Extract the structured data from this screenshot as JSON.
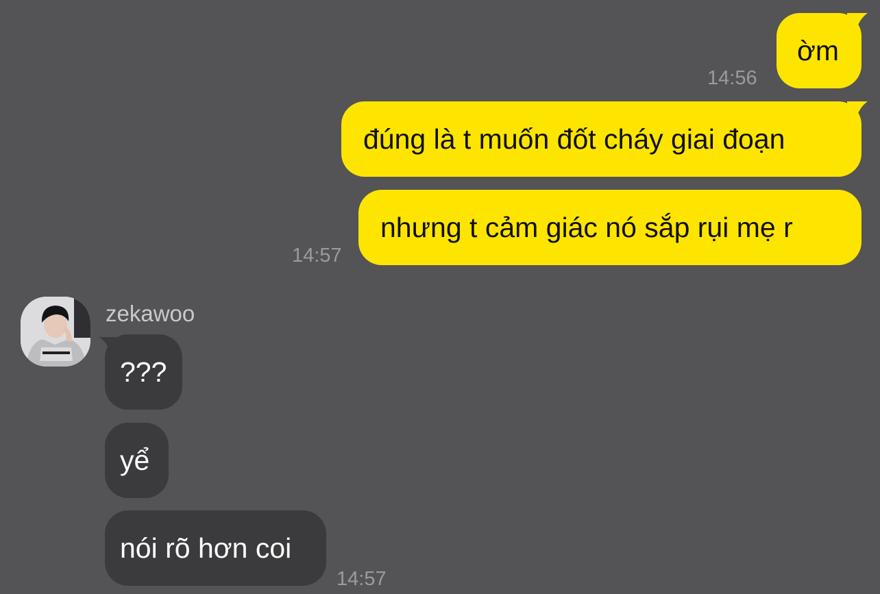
{
  "conversation": {
    "outgoing": [
      {
        "text": "ờm",
        "time": "14:56"
      },
      {
        "text": "đúng là t muốn đốt cháy giai đoạn"
      },
      {
        "text": "nhưng t cảm giác nó sắp rụi mẹ r",
        "time": "14:57"
      }
    ],
    "incoming_sender": "zekawoo",
    "incoming": [
      {
        "text": "???"
      },
      {
        "text": "yể"
      },
      {
        "text": "nói rõ hơn coi",
        "time": "14:57"
      }
    ]
  },
  "colors": {
    "background": "#545355",
    "outgoing_bubble": "#fee500",
    "incoming_bubble": "#3b3b3d",
    "timestamp": "#9b9a9c"
  }
}
